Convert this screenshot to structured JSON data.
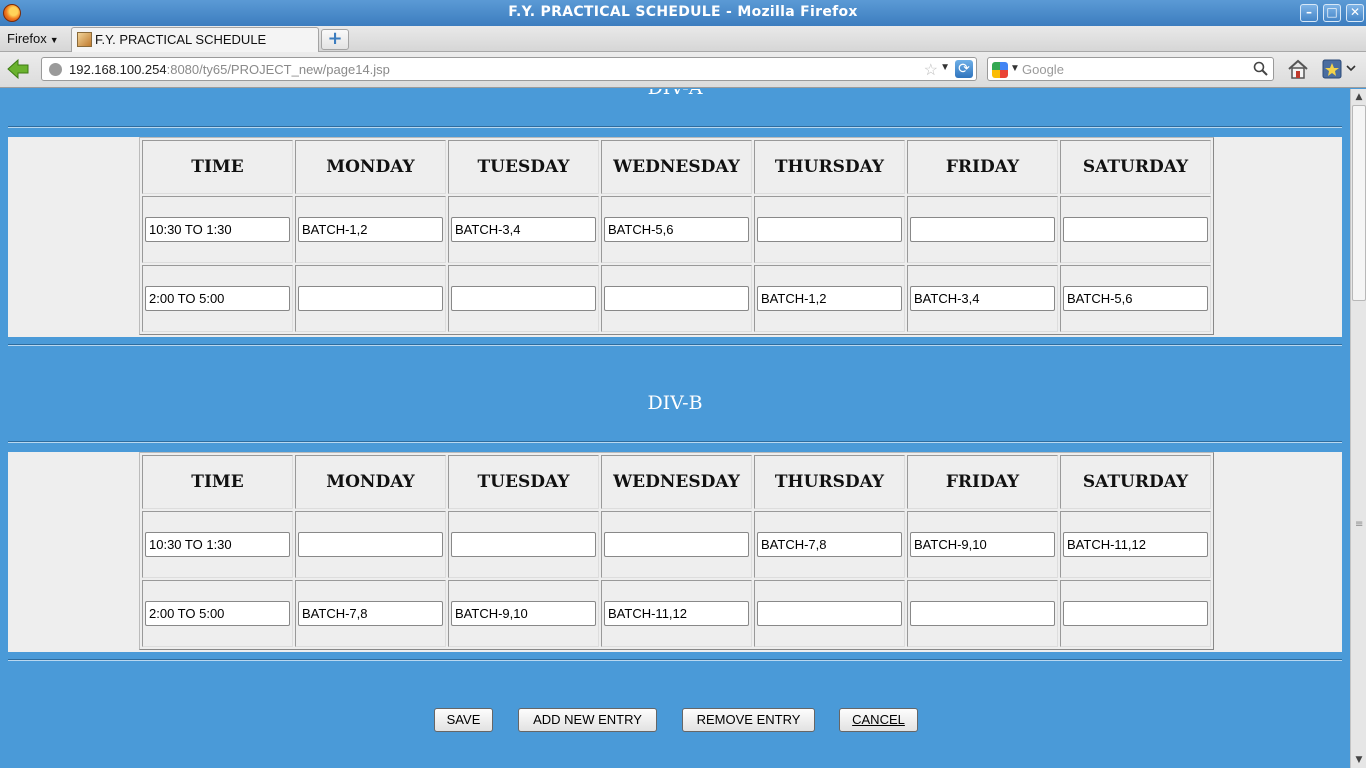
{
  "window": {
    "title": "F.Y. PRACTICAL SCHEDULE - Mozilla Firefox",
    "minimize": "–",
    "maximize": "□",
    "close": "✕"
  },
  "browser": {
    "menu_label": "Firefox",
    "tab_title": "F.Y. PRACTICAL SCHEDULE",
    "newtab_label": "+",
    "url_host": "192.168.100.254",
    "url_rest": ":8080/ty65/PROJECT_new/page14.jsp",
    "search_placeholder": "Google"
  },
  "icons": {
    "back": "back-arrow-icon",
    "home": "home-icon",
    "bookmark": "bookmark-star-icon",
    "reload": "reload-icon",
    "search": "magnifier-icon"
  },
  "headers": [
    "TIME",
    "MONDAY",
    "TUESDAY",
    "WEDNESDAY",
    "THURSDAY",
    "FRIDAY",
    "SATURDAY"
  ],
  "divisions": [
    {
      "name": "DIV-A",
      "rows": [
        [
          "10:30 TO 1:30",
          "BATCH-1,2",
          "BATCH-3,4",
          "BATCH-5,6",
          "",
          "",
          ""
        ],
        [
          "2:00 TO 5:00",
          "",
          "",
          "",
          "BATCH-1,2",
          "BATCH-3,4",
          "BATCH-5,6"
        ]
      ]
    },
    {
      "name": "DIV-B",
      "rows": [
        [
          "10:30 TO 1:30",
          "",
          "",
          "",
          "BATCH-7,8",
          "BATCH-9,10",
          "BATCH-11,12"
        ],
        [
          "2:00 TO 5:00",
          "BATCH-7,8",
          "BATCH-9,10",
          "BATCH-11,12",
          "",
          "",
          ""
        ]
      ]
    }
  ],
  "buttons": {
    "save": "SAVE",
    "add": "ADD NEW ENTRY",
    "remove": "REMOVE ENTRY",
    "cancel": "CANCEL"
  },
  "colors": {
    "page_background": "#4a9ad8",
    "table_band": "#eeeeee"
  }
}
